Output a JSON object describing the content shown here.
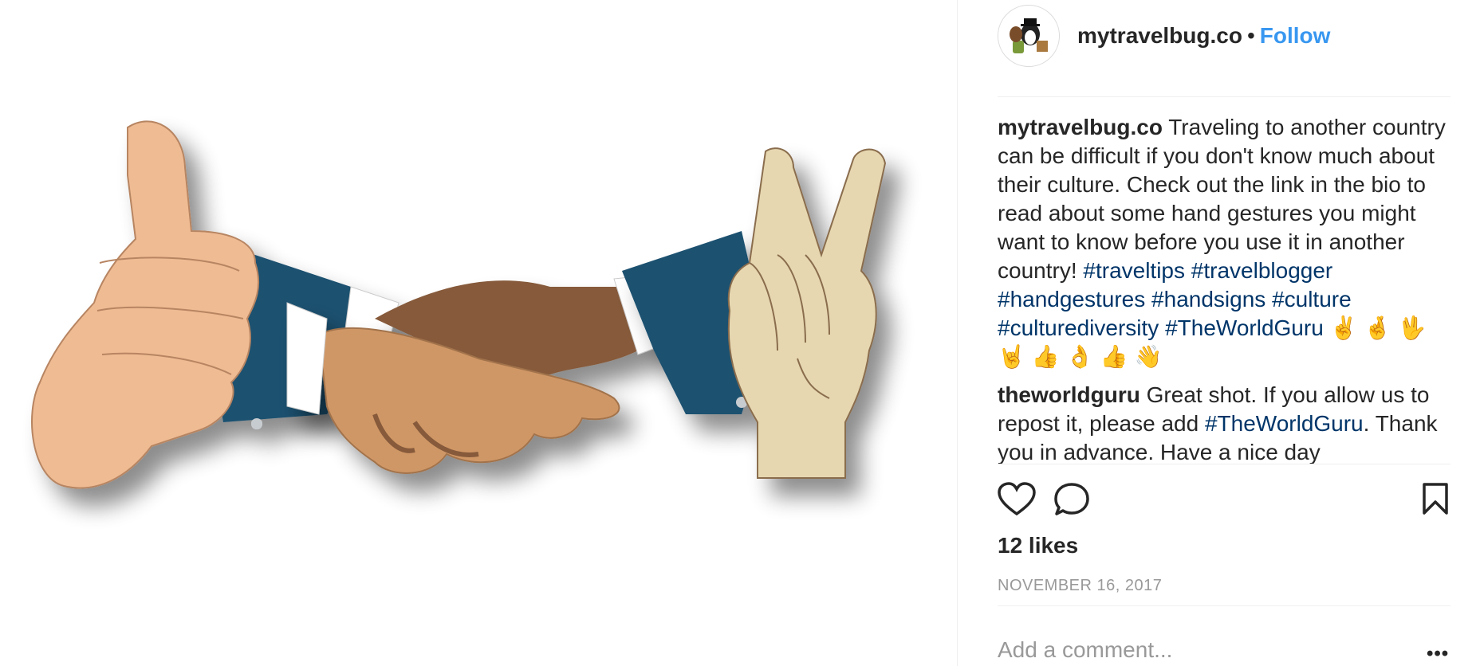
{
  "post": {
    "image_alt": "Illustration of hand gestures: thumbs up, handshake, and peace sign"
  },
  "header": {
    "username": "mytravelbug.co",
    "separator": "•",
    "follow_label": "Follow"
  },
  "caption": {
    "username": "mytravelbug.co",
    "text": "Traveling to another country can be difficult if you don't know much about their culture. Check out the link in the bio to read about some hand gestures you might want to know before you use it in another country!",
    "hashtags": [
      "#traveltips",
      "#travelblogger",
      "#handgestures",
      "#handsigns",
      "#culture",
      "#culturediversity",
      "#TheWorldGuru"
    ],
    "emojis": "✌️🤞🖖🤘👍👌👍👋"
  },
  "comments": [
    {
      "username": "theworldguru",
      "text_before": "Great shot. If you allow us to repost it, please add",
      "hashtag": "#TheWorldGuru",
      "text_after": ". Thank you in advance. Have a nice day"
    }
  ],
  "actions": {
    "like_icon": "heart-icon",
    "comment_icon": "comment-icon",
    "save_icon": "bookmark-icon"
  },
  "likes_label": "12 likes",
  "date": "NOVEMBER 16, 2017",
  "add_comment": {
    "placeholder": "Add a comment..."
  },
  "more_label": "•••",
  "colors": {
    "follow": "#3897f0",
    "hashtag": "#003569",
    "text": "#262626",
    "muted": "#999999",
    "divider": "#efefef"
  }
}
